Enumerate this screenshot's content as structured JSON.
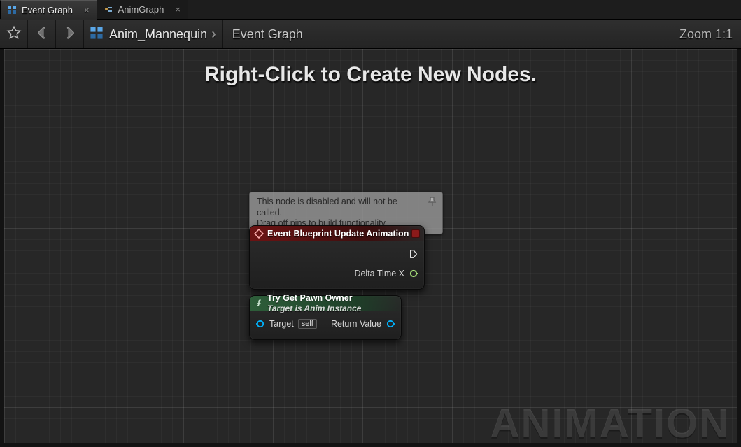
{
  "tabs": [
    {
      "label": "Event Graph",
      "kind": "graph",
      "close": "×"
    },
    {
      "label": "AnimGraph",
      "kind": "anim",
      "close": "×"
    }
  ],
  "toolbar": {
    "zoom_label": "Zoom 1:1"
  },
  "breadcrumb": {
    "blueprint": "Anim_Mannequin",
    "graph": "Event Graph"
  },
  "canvas": {
    "hint": "Right-Click to Create New Nodes.",
    "watermark": "ANIMATION"
  },
  "nodes": {
    "comment": {
      "line1": "This node is disabled and will not be called.",
      "line2": "Drag off pins to build functionality."
    },
    "event": {
      "title": "Event Blueprint Update Animation",
      "out_float": "Delta Time X"
    },
    "func": {
      "title": "Try Get Pawn Owner",
      "subtitle": "Target is Anim Instance",
      "in_target": "Target",
      "in_target_value": "self",
      "out_return": "Return Value"
    }
  },
  "colors": {
    "object_pin": "#00B4FF",
    "float_pin": "#A7E07A"
  }
}
